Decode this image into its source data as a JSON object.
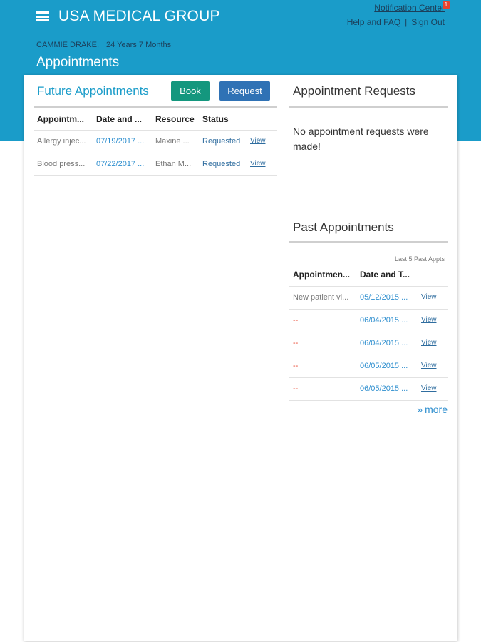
{
  "header": {
    "app_name": "USA MEDICAL GROUP",
    "notification_center": "Notification Center",
    "notification_count": "1",
    "help": "Help and FAQ",
    "separator": "|",
    "sign_out": "Sign Out"
  },
  "patient": {
    "name": "CAMMIE DRAKE,",
    "age": "24 Years 7 Months"
  },
  "page_title": "Appointments",
  "future": {
    "title": "Future Appointments",
    "book_label": "Book",
    "request_label": "Request",
    "columns": [
      "Appointm...",
      "Date and ...",
      "Resource",
      "Status"
    ],
    "rows": [
      {
        "type": "Allergy injec...",
        "date": "07/19/2017 ...",
        "resource": "Maxine ...",
        "status": "Requested",
        "view": "View"
      },
      {
        "type": "Blood press...",
        "date": "07/22/2017 ...",
        "resource": "Ethan M...",
        "status": "Requested",
        "view": "View"
      }
    ]
  },
  "requests": {
    "title": "Appointment Requests",
    "empty_message": "No appointment requests were made!"
  },
  "past": {
    "title": "Past Appointments",
    "caption": "Last 5 Past Appts",
    "columns": [
      "Appointmen...",
      "Date and T..."
    ],
    "rows": [
      {
        "type": "New patient vi...",
        "date": "05/12/2015 ...",
        "view": "View"
      },
      {
        "type": "--",
        "date": "06/04/2015 ...",
        "view": "View"
      },
      {
        "type": "--",
        "date": "06/04/2015 ...",
        "view": "View"
      },
      {
        "type": "--",
        "date": "06/05/2015 ...",
        "view": "View"
      },
      {
        "type": "--",
        "date": "06/05/2015 ...",
        "view": "View"
      }
    ],
    "more_label": "more",
    "more_icon": "»"
  },
  "colors": {
    "header_bg": "#1a9cc9",
    "book_button": "#14977e",
    "request_button": "#2f72b5",
    "badge": "#e8432c"
  }
}
